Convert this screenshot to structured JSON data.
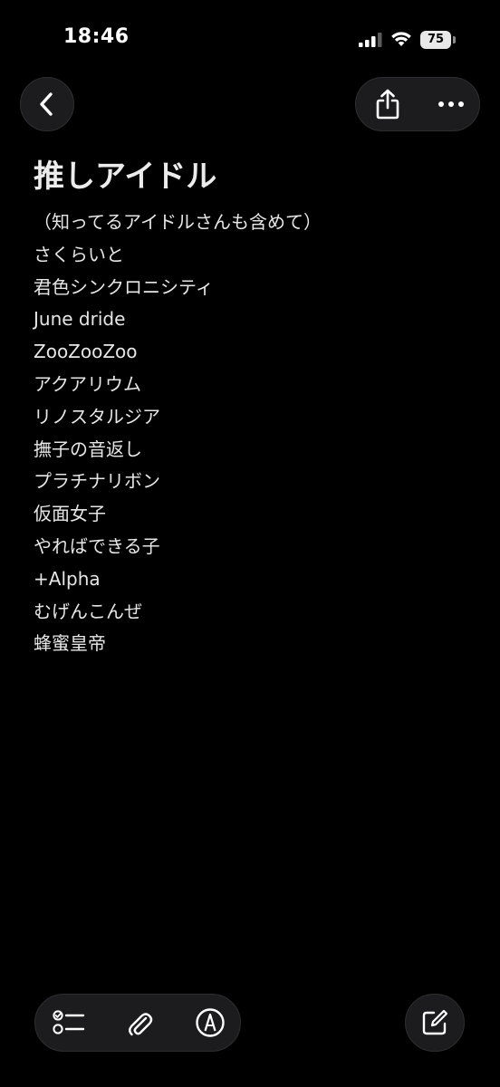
{
  "status_bar": {
    "time": "18:46",
    "battery_level": "75",
    "icons": [
      "cellular-signal-icon",
      "wifi-icon",
      "battery-icon"
    ]
  },
  "navigation": {
    "back_icon": "chevron-left-icon",
    "share_icon": "share-icon",
    "more_icon": "ellipsis-icon"
  },
  "note": {
    "title": "推しアイドル",
    "lines": [
      "（知ってるアイドルさんも含めて）",
      "さくらいと",
      "君色シンクロニシティ",
      "June dride",
      "ZooZooZoo",
      "アクアリウム",
      "リノスタルジア",
      "撫子の音返し",
      "プラチナリボン",
      "仮面女子",
      "やればできる子",
      "+Alpha",
      "むげんこんぜ",
      "蜂蜜皇帝"
    ]
  },
  "toolbar": {
    "icons": [
      "checklist-icon",
      "paperclip-icon",
      "markup-pen-icon",
      "compose-icon"
    ]
  },
  "colors": {
    "background": "#000000",
    "text": "#e6e6e6",
    "button_fill": "#1c1c1e"
  }
}
